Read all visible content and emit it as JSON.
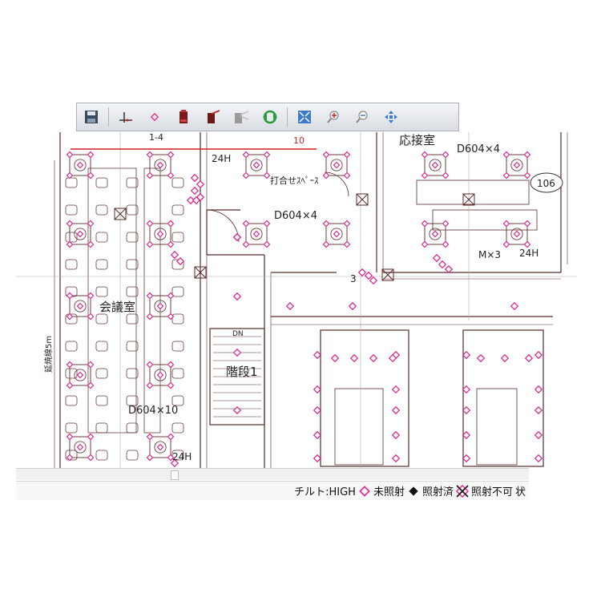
{
  "toolbar": {
    "buttons": [
      {
        "name": "save-icon"
      },
      {
        "name": "axis-icon"
      },
      {
        "name": "point-icon"
      },
      {
        "name": "device-red-icon"
      },
      {
        "name": "device-red-tilt-icon"
      },
      {
        "name": "device-gray-icon"
      },
      {
        "name": "refresh-icon"
      },
      {
        "name": "fit-screen-icon"
      },
      {
        "name": "zoom-in-icon"
      },
      {
        "name": "zoom-out-icon"
      },
      {
        "name": "pan-icon"
      }
    ]
  },
  "plan": {
    "marker_value": "10",
    "labels": {
      "top_left_code": "1-4",
      "h24_a": "24H",
      "h24_b": "24H",
      "h24_c": "24H",
      "meeting_space": "打合せｽﾍﾟｰｽ",
      "reception": "応接室",
      "d604x4_a": "D604×4",
      "d604x4_b": "D604×4",
      "room_106": "106",
      "mx3": "M×3",
      "num_3": "3",
      "conference": "会議室",
      "extension": "延焼線5m",
      "dn": "DN",
      "stairs": "階段1",
      "d604x10": "D604×10"
    }
  },
  "status": {
    "tilt": "チルト:HIGH",
    "not_irradiated": "未照射",
    "irradiated": "照射済",
    "not_possible": "照射不可",
    "state": "状"
  },
  "colors": {
    "sensor": "#e0218a",
    "wall": "#5a2a2a",
    "marker_line": "#d42020",
    "marker_text": "#d42020"
  }
}
